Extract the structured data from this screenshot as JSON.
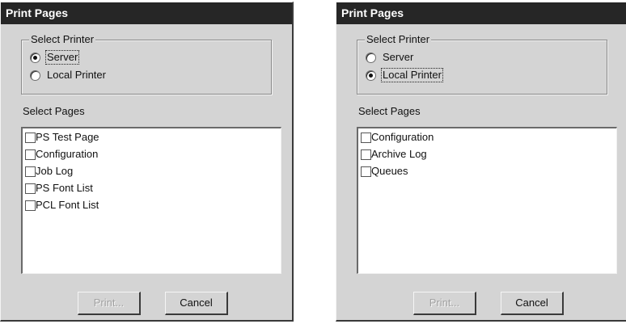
{
  "dialogs": [
    {
      "title": "Print Pages",
      "group_label": "Select Printer",
      "radios": [
        {
          "label": "Server",
          "selected": true
        },
        {
          "label": "Local Printer",
          "selected": false
        }
      ],
      "pages_label": "Select Pages",
      "pages": [
        "PS Test Page",
        "Configuration",
        "Job Log",
        "PS Font List",
        "PCL Font List"
      ],
      "print_label": "Print...",
      "cancel_label": "Cancel"
    },
    {
      "title": "Print Pages",
      "group_label": "Select Printer",
      "radios": [
        {
          "label": "Server",
          "selected": false
        },
        {
          "label": "Local Printer",
          "selected": true
        }
      ],
      "pages_label": "Select Pages",
      "pages": [
        "Configuration",
        "Archive Log",
        "Queues"
      ],
      "print_label": "Print...",
      "cancel_label": "Cancel"
    }
  ]
}
